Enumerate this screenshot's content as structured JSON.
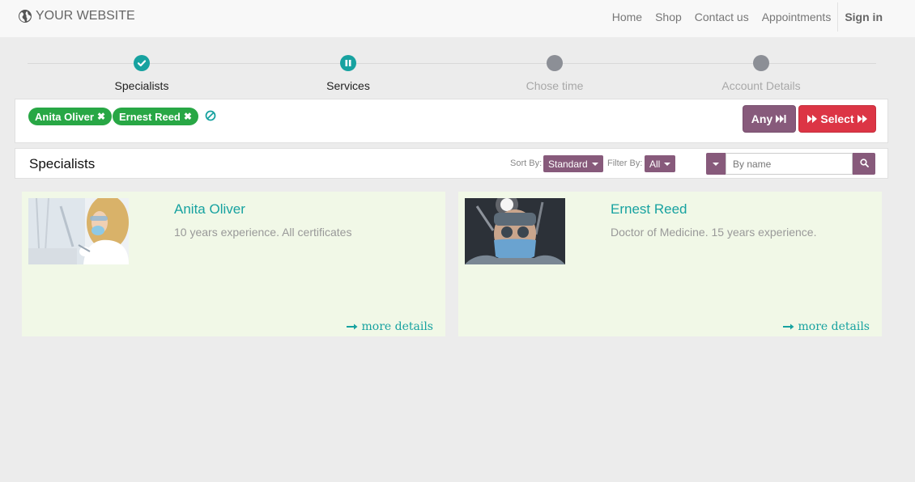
{
  "brand": {
    "name": "YOUR WEBSITE"
  },
  "nav": {
    "links": [
      "Home",
      "Shop",
      "Contact us",
      "Appointments"
    ],
    "signin": "Sign in"
  },
  "steps": [
    {
      "label": "Specialists",
      "state": "done"
    },
    {
      "label": "Services",
      "state": "current"
    },
    {
      "label": "Chose time",
      "state": "pending"
    },
    {
      "label": "Account Details",
      "state": "pending"
    }
  ],
  "selected": {
    "chips": [
      "Anita Oliver",
      "Ernest Reed"
    ],
    "any_label": "Any",
    "select_label": "Select"
  },
  "filter": {
    "title": "Specialists",
    "sort_label": "Sort By:",
    "sort_value": "Standard",
    "filter_label": "Filter By:",
    "filter_value": "All",
    "search_placeholder": "By name"
  },
  "cards": [
    {
      "name": "Anita Oliver",
      "description": "10 years experience. All certificates",
      "more": "more details"
    },
    {
      "name": "Ernest Reed",
      "description": "Doctor of Medicine. 15 years experience.",
      "more": "more details"
    }
  ],
  "colors": {
    "accent": "#17a2a0",
    "primary": "#875a7b",
    "danger": "#dc3545",
    "chip": "#28a745",
    "card_bg": "#f1f8e7"
  }
}
